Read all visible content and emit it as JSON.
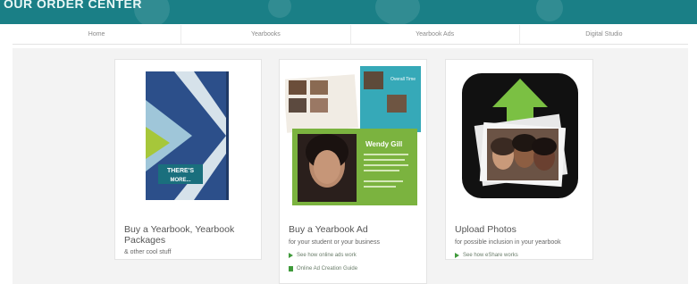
{
  "header": {
    "title": "OUR ORDER CENTER"
  },
  "nav": {
    "items": [
      {
        "label": "Home"
      },
      {
        "label": "Yearbooks"
      },
      {
        "label": "Yearbook Ads"
      },
      {
        "label": "Digital Studio"
      }
    ]
  },
  "cards": {
    "yearbook": {
      "title_line1": "Buy a Yearbook, Yearbook",
      "title_line2": "Packages",
      "subtitle": "& other cool stuff",
      "cover_text_1": "THERE'S",
      "cover_text_2": "MORE..."
    },
    "ad": {
      "title": "Buy a Yearbook Ad",
      "subtitle": "for your student or your business",
      "link_1": "See how online ads work",
      "link_2": "Online Ad Creation Guide",
      "ad_name": "Wendy Gill",
      "ad_headline": "Overall Time"
    },
    "upload": {
      "title": "Upload Photos",
      "subtitle": "for possible inclusion in your yearbook",
      "link_1": "See how eShare works"
    }
  },
  "colors": {
    "banner": "#1a7f86",
    "link_icon": "#3f9a3b",
    "ad_teal": "#36a9b8",
    "ad_green": "#7bb33f"
  }
}
